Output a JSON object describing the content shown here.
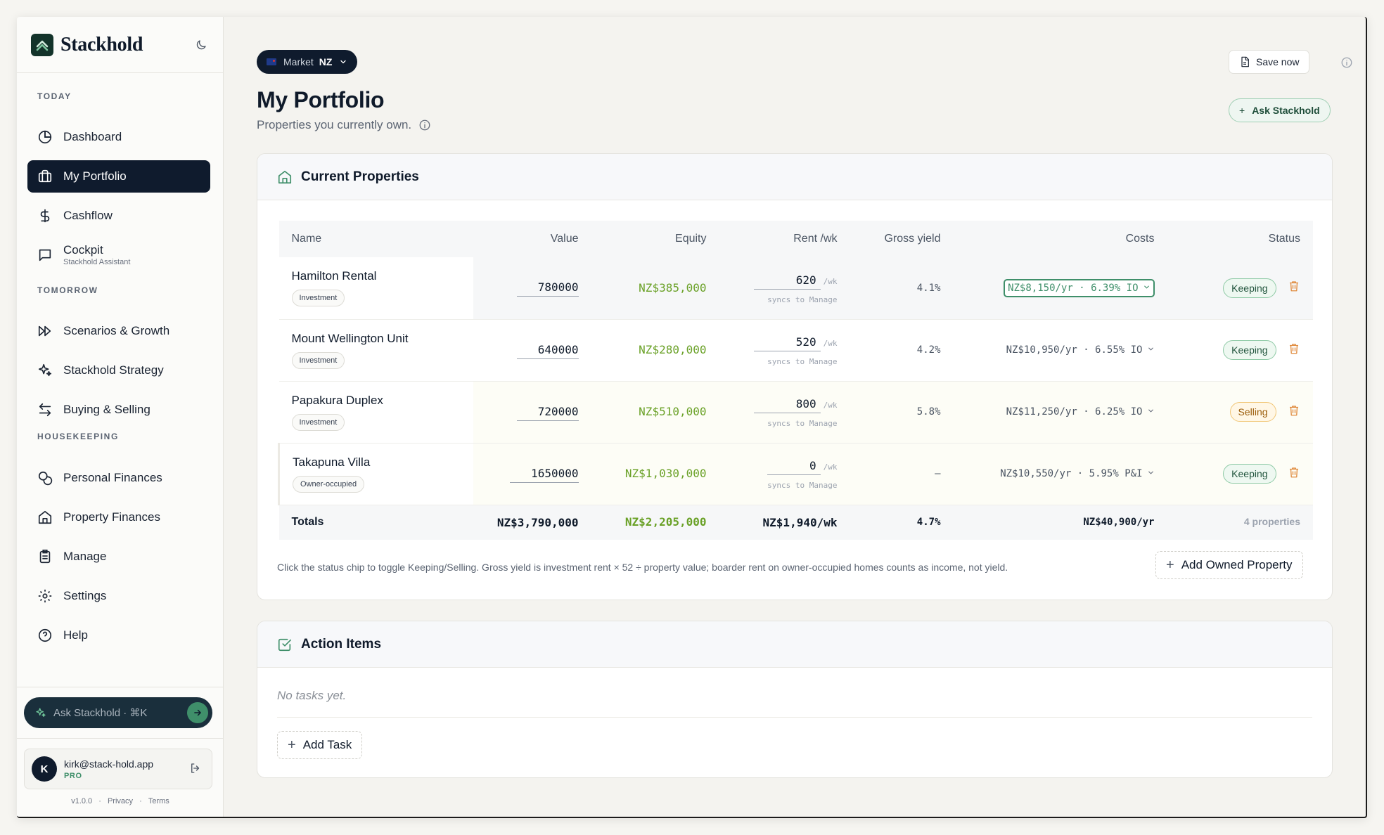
{
  "brand": {
    "name": "Stackhold"
  },
  "sidebar": {
    "sections": {
      "today": "TODAY",
      "tomorrow": "TOMORROW",
      "housekeeping": "HOUSEKEEPING"
    },
    "items": [
      {
        "label": "Dashboard",
        "icon": "pie-chart-icon"
      },
      {
        "label": "My Portfolio",
        "icon": "briefcase-icon",
        "active": true
      },
      {
        "label": "Cashflow",
        "icon": "dollar-icon"
      },
      {
        "label": "Cockpit",
        "sub": "Stackhold Assistant",
        "icon": "chat-icon"
      },
      {
        "label": "Scenarios & Growth",
        "icon": "fast-forward-icon"
      },
      {
        "label": "Stackhold Strategy",
        "icon": "sparkle-icon"
      },
      {
        "label": "Buying & Selling",
        "icon": "swap-arrows-icon"
      },
      {
        "label": "Personal Finances",
        "icon": "coins-icon"
      },
      {
        "label": "Property Finances",
        "icon": "home-icon"
      },
      {
        "label": "Manage",
        "icon": "clipboard-icon"
      },
      {
        "label": "Settings",
        "icon": "gear-icon"
      },
      {
        "label": "Help",
        "icon": "help-icon"
      }
    ],
    "ask_placeholder": "Ask Stackhold · ⌘K",
    "user": {
      "initial": "K",
      "email": "kirk@stack-hold.app",
      "plan": "PRO"
    },
    "footer": {
      "version": "v1.0.0",
      "privacy": "Privacy",
      "terms": "Terms",
      "sep": "·"
    }
  },
  "header": {
    "market_label": "Market",
    "market_value": "NZ",
    "title": "My Portfolio",
    "subtitle": "Properties you currently own.",
    "save_label": "Save now",
    "ask_label": "Ask Stackhold"
  },
  "properties_card": {
    "title": "Current Properties",
    "columns": [
      "Name",
      "Value",
      "Equity",
      "Rent /wk",
      "Gross yield",
      "Costs",
      "Status"
    ],
    "rows": [
      {
        "name": "Hamilton Rental",
        "type": "Investment",
        "value": "780000",
        "equity": "NZ$385,000",
        "rent": "620",
        "rent_unit": "/wk",
        "rent_sync": "syncs to Manage",
        "yield": "4.1%",
        "costs": "NZ$8,150/yr · 6.39% IO",
        "status": "Keeping"
      },
      {
        "name": "Mount Wellington Unit",
        "type": "Investment",
        "value": "640000",
        "equity": "NZ$280,000",
        "rent": "520",
        "rent_unit": "/wk",
        "rent_sync": "syncs to Manage",
        "yield": "4.2%",
        "costs": "NZ$10,950/yr · 6.55% IO",
        "status": "Keeping"
      },
      {
        "name": "Papakura Duplex",
        "type": "Investment",
        "value": "720000",
        "equity": "NZ$510,000",
        "rent": "800",
        "rent_unit": "/wk",
        "rent_sync": "syncs to Manage",
        "yield": "5.8%",
        "costs": "NZ$11,250/yr · 6.25% IO",
        "status": "Selling"
      },
      {
        "name": "Takapuna Villa",
        "type": "Owner-occupied",
        "value": "1650000",
        "equity": "NZ$1,030,000",
        "rent": "0",
        "rent_unit": "/wk",
        "rent_sync": "syncs to Manage",
        "yield": "—",
        "costs": "NZ$10,550/yr · 5.95% P&I",
        "status": "Keeping"
      }
    ],
    "totals": {
      "label": "Totals",
      "value": "NZ$3,790,000",
      "equity": "NZ$2,205,000",
      "rent": "NZ$1,940/wk",
      "yield": "4.7%",
      "costs": "NZ$40,900/yr",
      "count": "4 properties"
    },
    "note": "Click the status chip to toggle Keeping/Selling. Gross yield is investment rent × 52 ÷ property value; boarder rent on owner-occupied homes counts as income, not yield.",
    "add_label": "Add Owned Property"
  },
  "actions_card": {
    "title": "Action Items",
    "empty": "No tasks yet.",
    "add_label": "Add Task"
  },
  "colors": {
    "navy": "#0f1b2d",
    "accent_green": "#3f8f6a",
    "equity_green": "#6aa127",
    "selling_amber": "#9a5b07",
    "delete_orange": "#e08a3c"
  }
}
